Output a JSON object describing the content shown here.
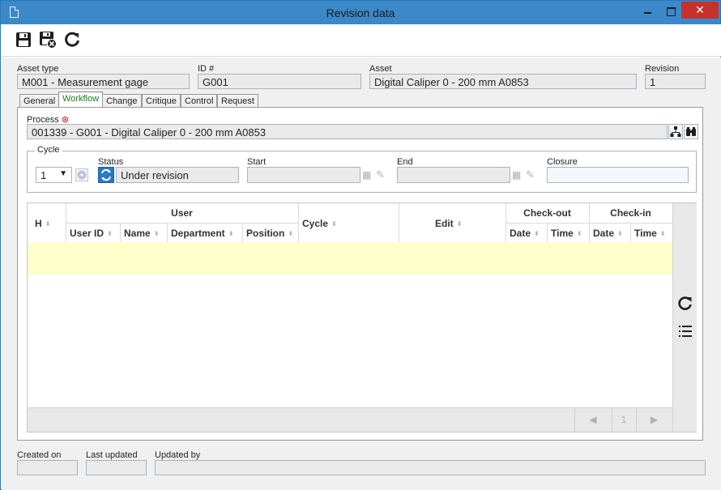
{
  "window": {
    "title": "Revision data",
    "close_glyph": "✕"
  },
  "toolbar": {
    "items": [
      "save-icon",
      "save-and-close-icon",
      "refresh-icon"
    ]
  },
  "header": {
    "asset_type_label": "Asset type",
    "asset_type_value": "M001 - Measurement gage",
    "id_label": "ID #",
    "id_value": "G001",
    "asset_label": "Asset",
    "asset_value": "Digital Caliper 0 - 200 mm A0853",
    "revision_label": "Revision",
    "revision_value": "1"
  },
  "tabs": [
    {
      "label": "General"
    },
    {
      "label": "Workflow",
      "active": true
    },
    {
      "label": "Change"
    },
    {
      "label": "Critique"
    },
    {
      "label": "Control"
    },
    {
      "label": "Request"
    }
  ],
  "workflow": {
    "process_label": "Process",
    "process_value": "001339 - G001 - Digital Caliper 0 - 200 mm A0853",
    "cycle_legend": "Cycle",
    "cycle_value": "1",
    "status_label": "Status",
    "status_value": "Under revision",
    "start_label": "Start",
    "start_value": "",
    "end_label": "End",
    "end_value": "",
    "closure_label": "Closure",
    "closure_value": ""
  },
  "grid": {
    "columns": {
      "h": "H",
      "user_group": "User",
      "user_id": "User ID",
      "name": "Name",
      "department": "Department",
      "position": "Position",
      "cycle": "Cycle",
      "edit": "Edit",
      "checkout_group": "Check-out",
      "checkin_group": "Check-in",
      "date": "Date",
      "time": "Time"
    },
    "rows": [],
    "pager": {
      "prev": "◀",
      "page": "1",
      "next": "▶"
    }
  },
  "footer": {
    "created_on_label": "Created on",
    "created_on_value": "",
    "last_updated_label": "Last updated",
    "last_updated_value": "",
    "updated_by_label": "Updated by",
    "updated_by_value": ""
  },
  "colors": {
    "titlebar": "#3b89c9",
    "close": "#c7312c",
    "active_tab": "#1a7a1a",
    "row_highlight": "#ffffcc",
    "required": "#cc0000"
  }
}
